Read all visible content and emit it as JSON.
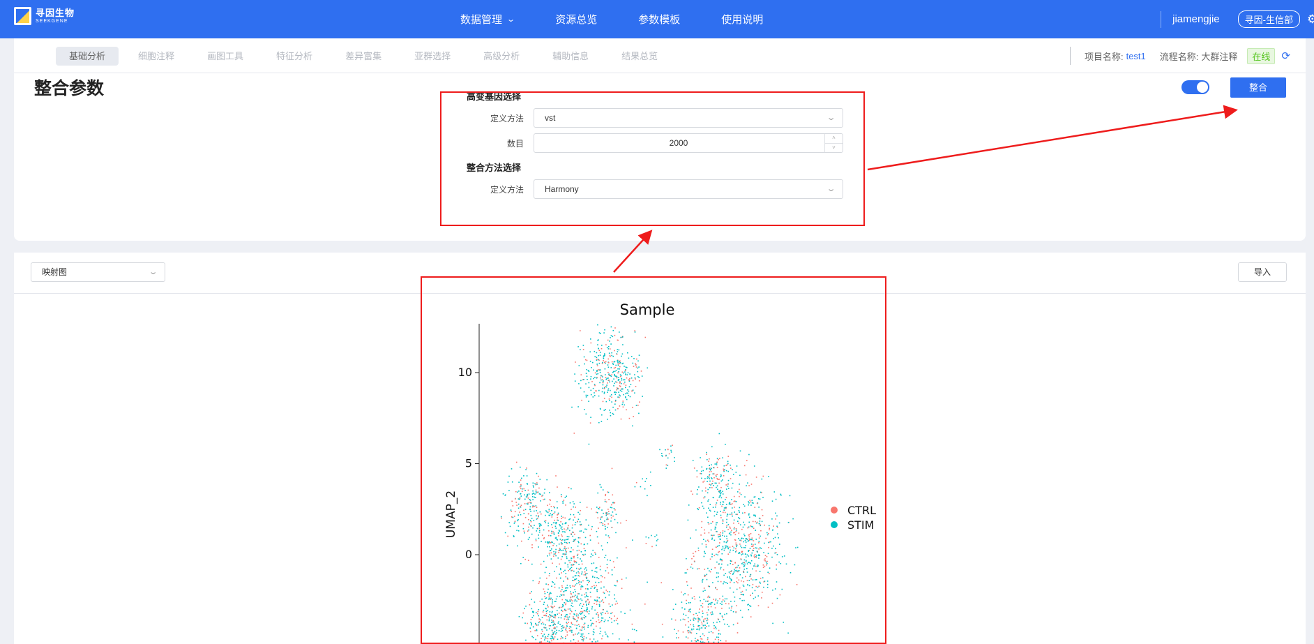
{
  "header": {
    "logo_cn": "寻因生物",
    "logo_en": "SEEKGENE",
    "nav": [
      {
        "label": "数据管理",
        "has_dropdown": true
      },
      {
        "label": "资源总览"
      },
      {
        "label": "参数模板"
      },
      {
        "label": "使用说明"
      }
    ],
    "username": "jiamengjie",
    "department": "寻因-生信部",
    "colors": {
      "brand": "#2f6ff0"
    }
  },
  "subnav": {
    "tabs": [
      "基础分析",
      "细胞注释",
      "画图工具",
      "特征分析",
      "差异富集",
      "亚群选择",
      "高级分析",
      "辅助信息",
      "结果总览"
    ],
    "active_tab": 0,
    "project_label": "项目名称:",
    "project_value": "test1",
    "flow_label": "流程名称:",
    "flow_value": "大群注释",
    "status": "在线"
  },
  "params": {
    "title": "整合参数",
    "toggle_on": true,
    "submit_label": "整合",
    "hvg_section": "高变基因选择",
    "hvg_method_label": "定义方法",
    "hvg_method_value": "vst",
    "count_label": "数目",
    "count_value": "2000",
    "integration_section": "整合方法选择",
    "integration_method_label": "定义方法",
    "integration_method_value": "Harmony"
  },
  "plot_panel": {
    "plot_type": "映射图",
    "import_label": "导入"
  },
  "chart_data": {
    "type": "scatter",
    "title": "Sample",
    "xlabel": "",
    "ylabel": "UMAP_2",
    "y_ticks": [
      0,
      5,
      10
    ],
    "legend": [
      {
        "name": "CTRL",
        "color": "#f8766d"
      },
      {
        "name": "STIM",
        "color": "#00bfc4"
      }
    ],
    "legend_position": "right",
    "clusters": [
      {
        "x": -3.2,
        "y": 10.2,
        "n": 260
      },
      {
        "x": -1.8,
        "y": 9.6,
        "n": 140
      },
      {
        "x": -8.2,
        "y": 2.8,
        "n": 200
      },
      {
        "x": -6.0,
        "y": 1.0,
        "n": 240
      },
      {
        "x": -4.6,
        "y": -2.8,
        "n": 600
      },
      {
        "x": -6.6,
        "y": -3.6,
        "n": 220
      },
      {
        "x": -3.0,
        "y": 2.2,
        "n": 80
      },
      {
        "x": 6.0,
        "y": 0.6,
        "n": 650
      },
      {
        "x": 4.4,
        "y": 3.8,
        "n": 150
      },
      {
        "x": 3.4,
        "y": -4.0,
        "n": 280
      },
      {
        "x": 1.0,
        "y": 5.4,
        "n": 20
      },
      {
        "x": -0.4,
        "y": 4.0,
        "n": 10
      },
      {
        "x": 0.1,
        "y": 0.8,
        "n": 10
      },
      {
        "x": 2.8,
        "y": 0.2,
        "n": 8
      }
    ]
  }
}
